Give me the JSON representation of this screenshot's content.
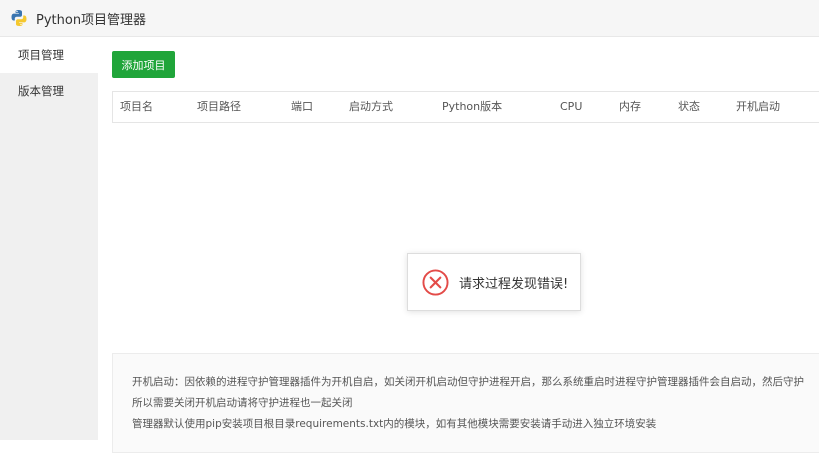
{
  "app": {
    "title": "Python项目管理器",
    "logo_icon": "python-icon"
  },
  "sidebar": {
    "items": [
      {
        "label": "项目管理",
        "active": true
      },
      {
        "label": "版本管理",
        "active": false
      }
    ]
  },
  "toolbar": {
    "add_label": "添加项目",
    "add_color": "#20a53a"
  },
  "table": {
    "columns": [
      "项目名",
      "项目路径",
      "端口",
      "启动方式",
      "Python版本",
      "CPU",
      "内存",
      "状态",
      "开机启动"
    ]
  },
  "toast": {
    "message": "请求过程发现错误!",
    "icon": "error-circle-icon",
    "icon_color": "#e34b48"
  },
  "notes": {
    "lines": [
      "开机启动：因依赖的进程守护管理器插件为开机自启，如关闭开机启动但守护进程开启，那么系统重启时进程守护管理器插件会自启动，然后守护",
      "所以需要关闭开机启动请将守护进程也一起关闭",
      "管理器默认使用pip安装项目根目录requirements.txt内的模块，如有其他模块需要安装请手动进入独立环境安装"
    ]
  }
}
